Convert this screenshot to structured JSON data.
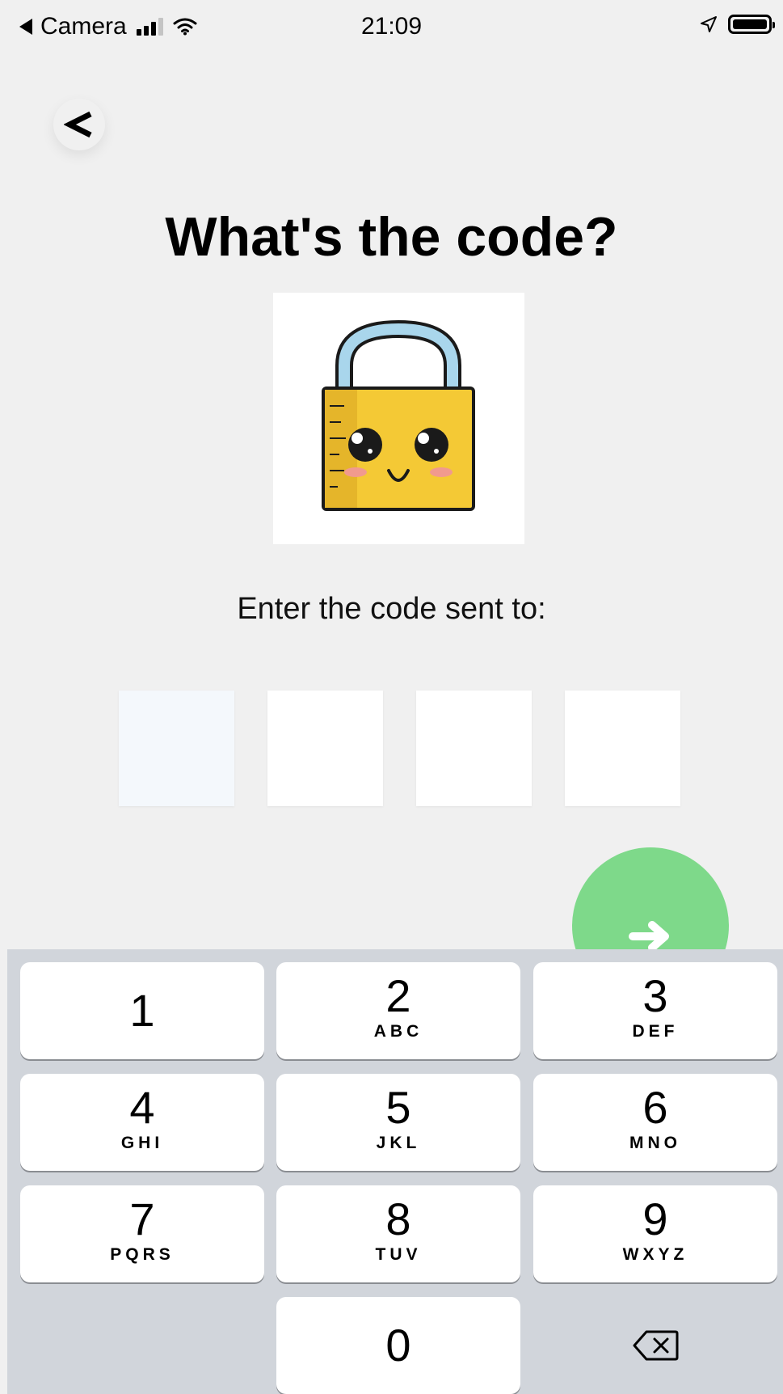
{
  "status_bar": {
    "back_app": "Camera",
    "time": "21:09",
    "signal_icon": "cellular-signal-icon",
    "wifi_icon": "wifi-icon",
    "location_icon": "location-arrow-icon",
    "battery_icon": "battery-icon"
  },
  "header": {
    "back_label": "<",
    "back_icon": "chevron-left-icon"
  },
  "main": {
    "title": "What's the code?",
    "illustration": "padlock-mascot-illustration",
    "subtitle": "Enter the code sent to:",
    "code_boxes": [
      {
        "value": "",
        "active": true
      },
      {
        "value": "",
        "active": false
      },
      {
        "value": "",
        "active": false
      },
      {
        "value": "",
        "active": false
      }
    ],
    "next_icon": "arrow-right-icon"
  },
  "colors": {
    "background": "#f0f0f0",
    "accent_green": "#7ed98a",
    "active_box": "#f4f8fc",
    "keyboard_bg": "#d1d5db",
    "lock_yellow": "#f4c935",
    "shackle_blue": "#a9d6ec"
  },
  "keyboard": {
    "keys": [
      {
        "digit": "1",
        "letters": ""
      },
      {
        "digit": "2",
        "letters": "ABC"
      },
      {
        "digit": "3",
        "letters": "DEF"
      },
      {
        "digit": "4",
        "letters": "GHI"
      },
      {
        "digit": "5",
        "letters": "JKL"
      },
      {
        "digit": "6",
        "letters": "MNO"
      },
      {
        "digit": "7",
        "letters": "PQRS"
      },
      {
        "digit": "8",
        "letters": "TUV"
      },
      {
        "digit": "9",
        "letters": "WXYZ"
      },
      {
        "digit": "0",
        "letters": ""
      }
    ],
    "delete_icon": "backspace-icon"
  }
}
